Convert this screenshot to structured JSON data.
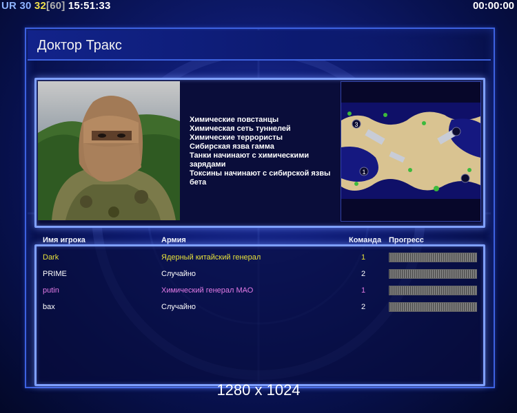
{
  "hud": {
    "ur_label": "UR",
    "ur_value": "30",
    "fps": "32",
    "fps_max": "[60]",
    "clock": "15:51:33",
    "timer": "00:00:00"
  },
  "screen": {
    "title": "Доктор Тракс",
    "resolution": "1280 x 1024"
  },
  "rules": [
    "Химические повстанцы",
    "Химическая сеть туннелей",
    "Химические террористы",
    "Сибирская язва гамма",
    "Танки начинают с химическими",
    " зарядами",
    "Токсины начинают с сибирской язвы",
    " бета"
  ],
  "table": {
    "headers": {
      "name": "Имя игрока",
      "army": "Армия",
      "team": "Команда",
      "progress": "Прогресс"
    },
    "rows": [
      {
        "name": "Dark",
        "army": "Ядерный китайский генерал",
        "team": "1",
        "color": "#e8e23a"
      },
      {
        "name": "PRIME",
        "army": "Случайно",
        "team": "2",
        "color": "#ffffff"
      },
      {
        "name": "putin",
        "army": "Химический генерал МАО",
        "team": "1",
        "color": "#e37be6"
      },
      {
        "name": "bax",
        "army": "Случайно",
        "team": "2",
        "color": "#ffffff"
      }
    ]
  },
  "map": {
    "start_markers": [
      "1",
      "3"
    ]
  },
  "colors": {
    "frame": "#3d62e0",
    "panel_border": "#7fa0ff",
    "background": "#0f1c73"
  }
}
